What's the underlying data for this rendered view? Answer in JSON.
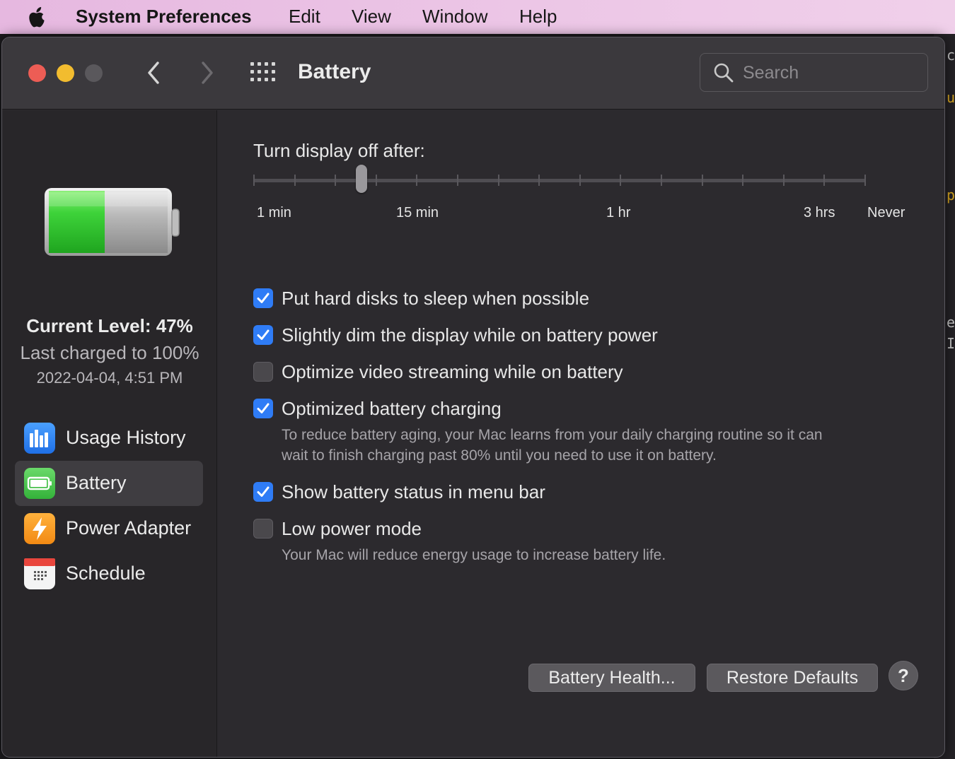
{
  "menubar": {
    "app_name": "System Preferences",
    "items": [
      "Edit",
      "View",
      "Window",
      "Help"
    ]
  },
  "window": {
    "title": "Battery",
    "search_placeholder": "Search"
  },
  "sidebar": {
    "current_level": "Current Level: 47%",
    "battery_percent": 47,
    "last_charged": "Last charged to 100%",
    "charged_date": "2022-04-04, 4:51 PM",
    "items": [
      {
        "label": "Usage History",
        "icon": "bar-chart-icon",
        "active": false
      },
      {
        "label": "Battery",
        "icon": "battery-icon",
        "active": true
      },
      {
        "label": "Power Adapter",
        "icon": "lightning-icon",
        "active": false
      },
      {
        "label": "Schedule",
        "icon": "calendar-icon",
        "active": false
      }
    ]
  },
  "display_slider": {
    "label": "Turn display off after:",
    "ticks": [
      "1 min",
      "15 min",
      "1 hr",
      "3 hrs",
      "Never"
    ],
    "tick_count": 16,
    "selected_tick_index": 3
  },
  "options": [
    {
      "label": "Put hard disks to sleep when possible",
      "checked": true
    },
    {
      "label": "Slightly dim the display while on battery power",
      "checked": true
    },
    {
      "label": "Optimize video streaming while on battery",
      "checked": false
    },
    {
      "label": "Optimized battery charging",
      "checked": true,
      "description_lines": [
        "To reduce battery aging, your Mac learns from your daily charging routine so it can",
        "wait to finish charging past 80% until you need to use it on battery."
      ]
    },
    {
      "label": "Show battery status in menu bar",
      "checked": true
    },
    {
      "label": "Low power mode",
      "checked": false,
      "description_lines": [
        "Your Mac will reduce energy usage to increase battery life."
      ]
    }
  ],
  "buttons": {
    "battery_health": "Battery Health...",
    "restore_defaults": "Restore Defaults",
    "help": "?"
  },
  "colors": {
    "checkbox_on": "#2f7cf6",
    "battery_green": "#3ed33a",
    "window_bg": "#2c2a2e"
  }
}
